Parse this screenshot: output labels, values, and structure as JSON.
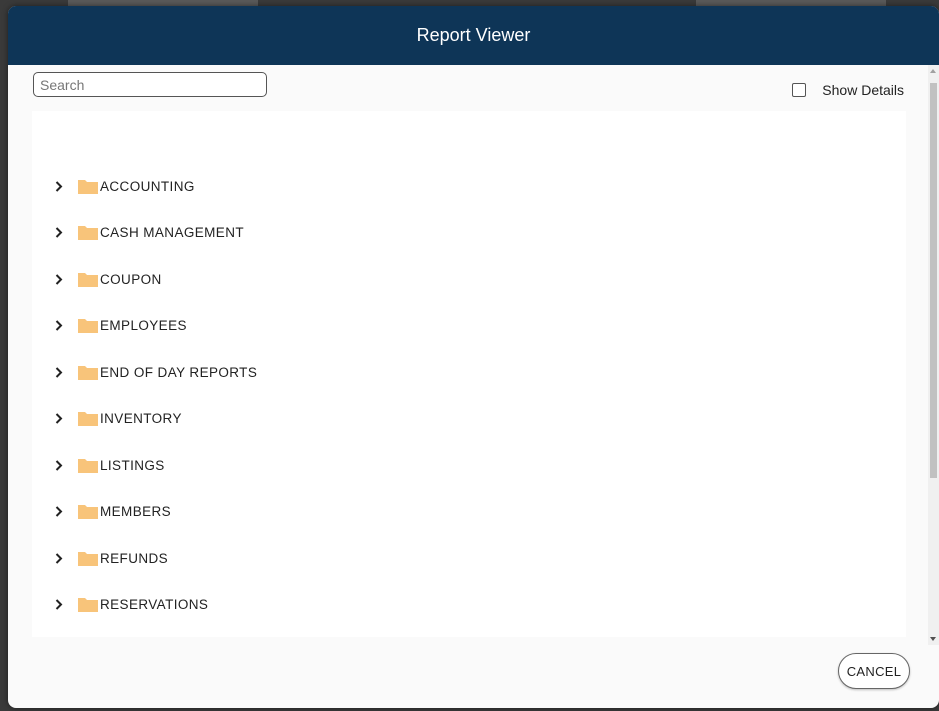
{
  "dialog": {
    "title": "Report Viewer"
  },
  "toolbar": {
    "search_placeholder": "Search",
    "search_value": "",
    "show_details_label": "Show Details",
    "show_details_checked": false
  },
  "tree": {
    "items": [
      {
        "label": "ACCOUNTING",
        "icon": "folder-icon",
        "expand_icon": "chevron-right-icon"
      },
      {
        "label": "CASH MANAGEMENT",
        "icon": "folder-icon",
        "expand_icon": "chevron-right-icon"
      },
      {
        "label": "COUPON",
        "icon": "folder-icon",
        "expand_icon": "chevron-right-icon"
      },
      {
        "label": "EMPLOYEES",
        "icon": "folder-icon",
        "expand_icon": "chevron-right-icon"
      },
      {
        "label": "END OF DAY REPORTS",
        "icon": "folder-icon",
        "expand_icon": "chevron-right-icon"
      },
      {
        "label": "INVENTORY",
        "icon": "folder-icon",
        "expand_icon": "chevron-right-icon"
      },
      {
        "label": "LISTINGS",
        "icon": "folder-icon",
        "expand_icon": "chevron-right-icon"
      },
      {
        "label": "MEMBERS",
        "icon": "folder-icon",
        "expand_icon": "chevron-right-icon"
      },
      {
        "label": "REFUNDS",
        "icon": "folder-icon",
        "expand_icon": "chevron-right-icon"
      },
      {
        "label": "RESERVATIONS",
        "icon": "folder-icon",
        "expand_icon": "chevron-right-icon"
      }
    ]
  },
  "footer": {
    "cancel_label": "CANCEL"
  },
  "colors": {
    "titlebar": "#0e3557",
    "folder": "#f8c47a",
    "background": "#fafafa"
  }
}
